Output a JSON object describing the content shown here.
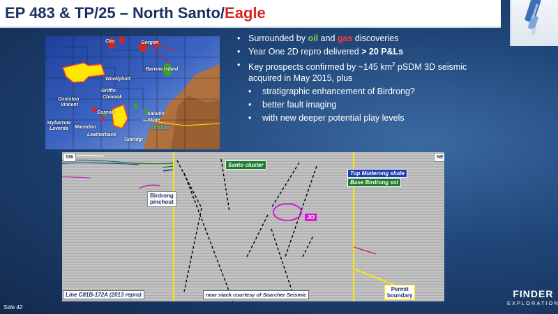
{
  "title": {
    "main": "EP 483 & TP/25 – North Santo/",
    "accent": "Eagle"
  },
  "colors": {
    "title": "#1b2f63",
    "accent": "#d8261e",
    "background": "#1f4577",
    "oil": "#7fd43a",
    "gas": "#ff3b2f",
    "permit_line": "#ffe800"
  },
  "bullets": {
    "b1_prefix": "Surrounded by ",
    "b1_oil": "oil",
    "b1_and": " and ",
    "b1_gas": "gas",
    "b1_suffix": " discoveries",
    "b2_prefix": "Year One 2D repro delivered ",
    "b2_bold": "> 20 P&Ls",
    "b3_prefix": "Key prospects confirmed by ~145 km",
    "b3_sup": "2",
    "b3_suffix": " pSDM 3D seismic acquired in May 2015, plus",
    "sub": [
      "stratigraphic enhancement of Birdrong?",
      "better fault imaging",
      "with new deeper potential play levels"
    ]
  },
  "map": {
    "labels": [
      "Clio",
      "Gorgon",
      "Barrow Island",
      "Woollybutt",
      "Griffin",
      "Chinook",
      "Coniston",
      "Vincent",
      "Corowa",
      "Saladin",
      "Skate",
      "Onslow",
      "Stybarrow",
      "Laverda",
      "Macedon",
      "Leatherback",
      "Tubridgi"
    ]
  },
  "seismic": {
    "sw": "SW",
    "ne": "NE",
    "santo_cluster": "Santo cluster",
    "top_muderong": "Top Muderong shale",
    "base_birdrong": "Base Birdrong sst",
    "birdrong_pinchout_1": "Birdrong",
    "birdrong_pinchout_2": "pinchout",
    "jo": "JO",
    "line_label": "Line C81B-172A (2013 repro)",
    "courtesy": "near stack courtesy of Searcher Seismic",
    "permit_1": "Permit",
    "permit_2": "boundary"
  },
  "footer": {
    "side": "Side 42",
    "brand": "FINDER",
    "brand_sub": "EXPLORATION"
  }
}
